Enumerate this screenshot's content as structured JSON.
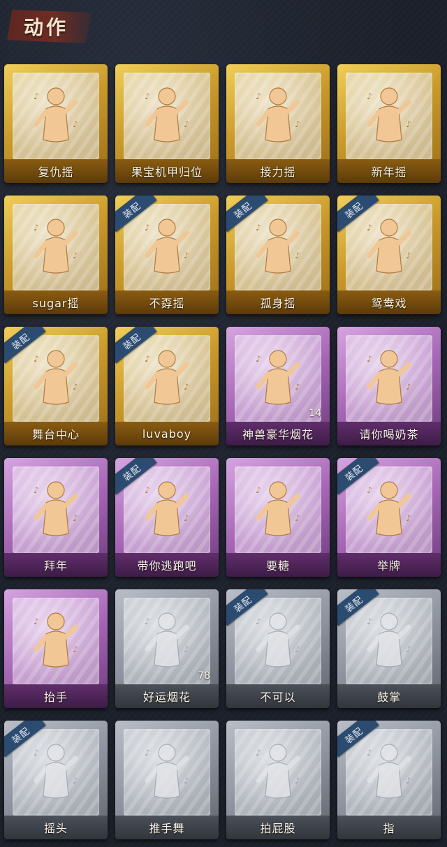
{
  "page": {
    "title": "动作"
  },
  "colors": {
    "gold": "#c9992a",
    "purple": "#a565b4",
    "gray": "#8d939e",
    "badge": "#2c4b70"
  },
  "badge_label": "装配",
  "cards": [
    {
      "label": "复仇摇",
      "tier": "gold",
      "equipped": false,
      "count": null,
      "icon": "dance-raise-arm-icon"
    },
    {
      "label": "果宝机甲归位",
      "tier": "gold",
      "equipped": false,
      "count": null,
      "icon": "dance-hands-hips-icon"
    },
    {
      "label": "接力摇",
      "tier": "gold",
      "equipped": false,
      "count": null,
      "icon": "dance-arms-wave-icon"
    },
    {
      "label": "新年摇",
      "tier": "gold",
      "equipped": false,
      "count": null,
      "icon": "dance-clap-icon"
    },
    {
      "label": "sugar摇",
      "tier": "gold",
      "equipped": false,
      "count": null,
      "icon": "dance-sway-icon"
    },
    {
      "label": "不孬摇",
      "tier": "gold",
      "equipped": true,
      "count": null,
      "icon": "dance-point-up-icon"
    },
    {
      "label": "孤身摇",
      "tier": "gold",
      "equipped": true,
      "count": null,
      "icon": "dance-stars-icon"
    },
    {
      "label": "鸳鸯戏",
      "tier": "gold",
      "equipped": true,
      "count": null,
      "icon": "dance-music-icon"
    },
    {
      "label": "舞台中心",
      "tier": "gold",
      "equipped": true,
      "count": null,
      "icon": "dance-sparkle-icon"
    },
    {
      "label": "luvaboy",
      "tier": "gold",
      "equipped": true,
      "count": null,
      "icon": "dance-cross-arms-icon"
    },
    {
      "label": "神兽豪华烟花",
      "tier": "purple",
      "equipped": false,
      "count": "14",
      "icon": "fireworks-pot-icon"
    },
    {
      "label": "请你喝奶茶",
      "tier": "purple",
      "equipped": false,
      "count": null,
      "icon": "hold-sign-icon"
    },
    {
      "label": "拜年",
      "tier": "purple",
      "equipped": false,
      "count": null,
      "icon": "bow-greeting-icon"
    },
    {
      "label": "带你逃跑吧",
      "tier": "purple",
      "equipped": true,
      "count": null,
      "icon": "dance-run-icon"
    },
    {
      "label": "要糖",
      "tier": "purple",
      "equipped": false,
      "count": null,
      "icon": "reach-out-icon"
    },
    {
      "label": "举牌",
      "tier": "purple",
      "equipped": true,
      "count": null,
      "icon": "raise-sign-icon"
    },
    {
      "label": "抬手",
      "tier": "purple",
      "equipped": false,
      "count": null,
      "icon": "raise-hand-icon"
    },
    {
      "label": "好运烟花",
      "tier": "gray",
      "equipped": false,
      "count": "78",
      "icon": "firework-can-icon"
    },
    {
      "label": "不可以",
      "tier": "gray",
      "equipped": true,
      "count": null,
      "icon": "finger-wag-icon"
    },
    {
      "label": "鼓掌",
      "tier": "gray",
      "equipped": true,
      "count": null,
      "icon": "clapping-hands-icon"
    },
    {
      "label": "摇头",
      "tier": "gray",
      "equipped": true,
      "count": null,
      "icon": "shake-head-icon"
    },
    {
      "label": "推手舞",
      "tier": "gray",
      "equipped": false,
      "count": null,
      "icon": "push-hands-icon"
    },
    {
      "label": "拍屁股",
      "tier": "gray",
      "equipped": false,
      "count": null,
      "icon": "slap-hip-icon"
    },
    {
      "label": "指",
      "tier": "gray",
      "equipped": true,
      "count": null,
      "icon": "point-icon"
    }
  ]
}
